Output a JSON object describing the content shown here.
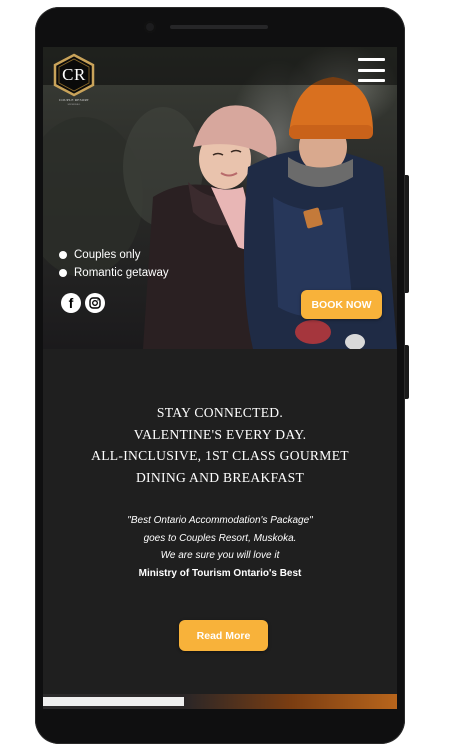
{
  "logo": {
    "monogram": "CR",
    "name": "COUPLE RESORT",
    "tagline": "MUSKOKA"
  },
  "features": [
    "Couples only",
    "Romantic getaway"
  ],
  "socials": [
    {
      "icon": "facebook-icon",
      "glyph": "f"
    },
    {
      "icon": "instagram-icon"
    }
  ],
  "book_button": "BOOK NOW",
  "headline_lines": [
    "STAY CONNECTED.",
    "VALENTINE'S EVERY DAY.",
    "ALL-INCLUSIVE, 1ST CLASS GOURMET",
    "DINING AND BREAKFAST"
  ],
  "quote_lines": [
    "\"Best Ontario Accommodation's Package\"",
    "goes to Couples Resort, Muskoka.",
    "We are sure you will love it"
  ],
  "quote_source": "Ministry of Tourism Ontario's Best",
  "read_more_button": "Read More",
  "colors": {
    "accent": "#f8b23a",
    "background": "#1f1f1f",
    "phone": "#0f0f10"
  }
}
